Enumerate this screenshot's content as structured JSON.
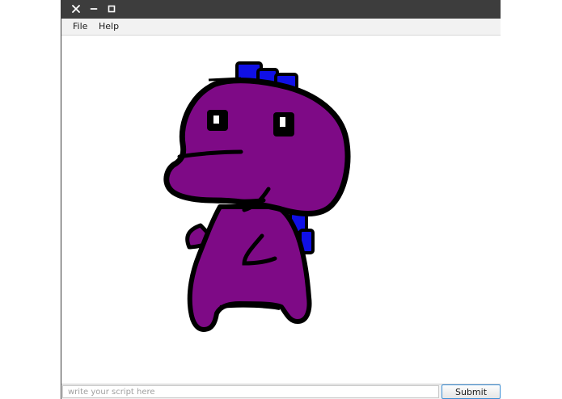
{
  "window": {
    "controls": {
      "close_icon": "close-icon",
      "minimize_icon": "minimize-icon",
      "maximize_icon": "maximize-icon"
    }
  },
  "menu": {
    "items": [
      {
        "label": "File"
      },
      {
        "label": "Help"
      }
    ]
  },
  "canvas": {
    "drawing": "purple-dinosaur-drawing",
    "colors": {
      "body": "#7e0a86",
      "outline": "#000000",
      "spikes": "#1010e6",
      "eye_white": "#ffffff"
    }
  },
  "bottom": {
    "input_value": "",
    "input_placeholder": "write your script here",
    "submit_label": "Submit"
  }
}
